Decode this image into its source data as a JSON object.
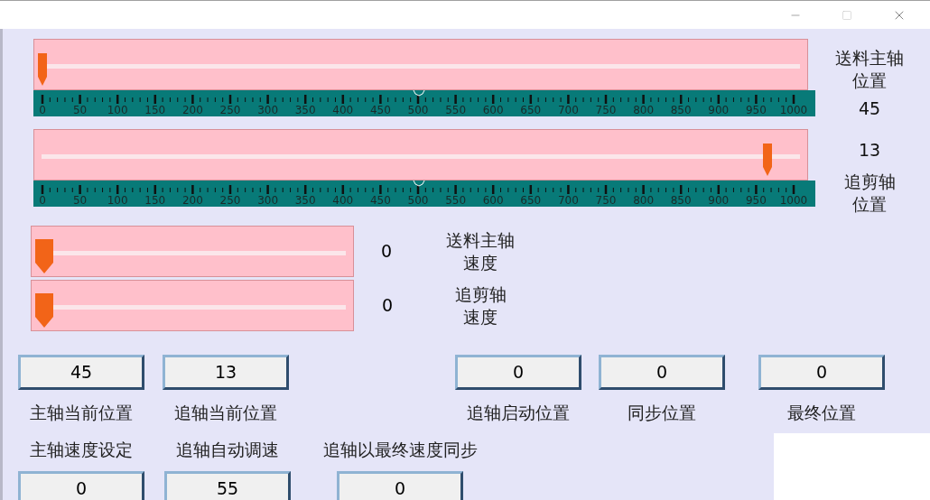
{
  "position_sliders": [
    {
      "label_lines": [
        "送料主轴",
        "位置"
      ],
      "reading": "45",
      "level": 0.0,
      "scale": [
        "0",
        "50",
        "100",
        "150",
        "200",
        "250",
        "300",
        "350",
        "400",
        "450",
        "500",
        "550",
        "600",
        "650",
        "700",
        "750",
        "800",
        "850",
        "900",
        "950",
        "1000"
      ]
    },
    {
      "label_lines": [
        "追剪轴",
        "位置"
      ],
      "reading": "13",
      "level": 0.97,
      "scale": [
        "0",
        "50",
        "100",
        "150",
        "200",
        "250",
        "300",
        "350",
        "400",
        "450",
        "500",
        "550",
        "600",
        "650",
        "700",
        "750",
        "800",
        "850",
        "900",
        "950",
        "1000"
      ]
    }
  ],
  "speed_sliders": [
    {
      "label_lines": [
        "送料主轴",
        "速度"
      ],
      "reading": "0",
      "level": 0.0
    },
    {
      "label_lines": [
        "追剪轴",
        "速度"
      ],
      "reading": "0",
      "level": 0.0
    }
  ],
  "position_fields": [
    {
      "value": "45",
      "label": "主轴当前位置"
    },
    {
      "value": "13",
      "label": "追轴当前位置"
    },
    {
      "value": "0",
      "label": "追轴启动位置"
    },
    {
      "value": "0",
      "label": "同步位置"
    },
    {
      "value": "0",
      "label": "最终位置"
    }
  ],
  "speed_fields": [
    {
      "label": "主轴速度设定",
      "value": "0"
    },
    {
      "label": "追轴自动调速",
      "value": "55"
    },
    {
      "label": "追轴以最终速度同步",
      "value": "0"
    }
  ]
}
